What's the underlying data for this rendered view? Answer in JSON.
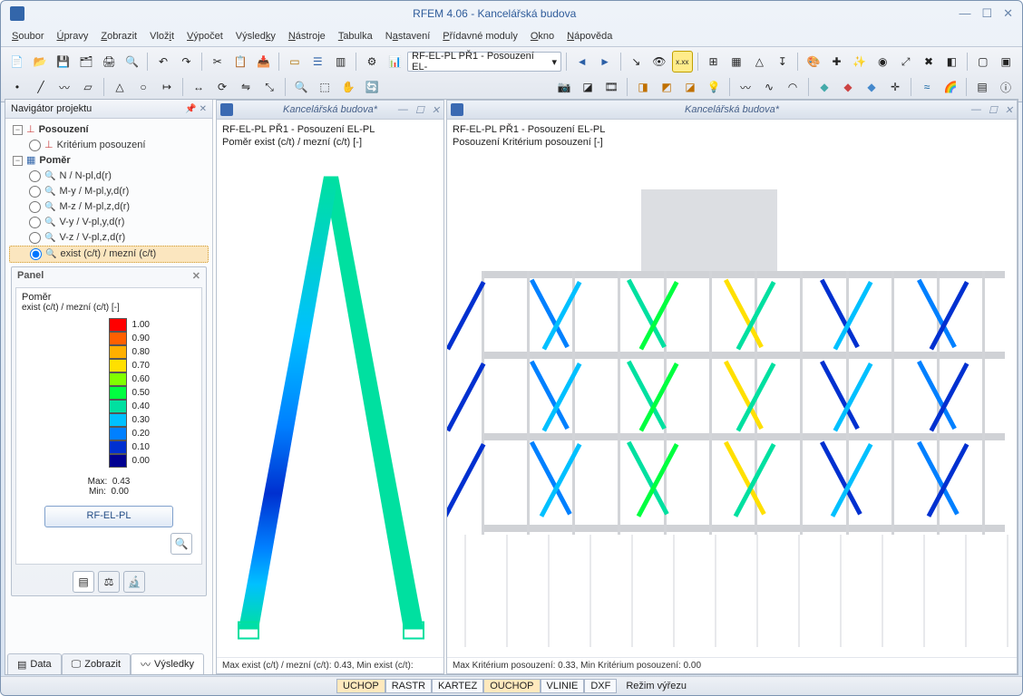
{
  "app": {
    "title": "RFEM 4.06 - Kancelářská budova"
  },
  "menu": {
    "items": [
      "Soubor",
      "Úpravy",
      "Zobrazit",
      "Vložit",
      "Výpočet",
      "Výsledky",
      "Nástroje",
      "Tabulka",
      "Nastavení",
      "Přídavné moduly",
      "Okno",
      "Nápověda"
    ]
  },
  "toolbar": {
    "combo": "RF-EL-PL PŘ1 - Posouzení EL-"
  },
  "navigator": {
    "title": "Navigátor projektu",
    "nodes": {
      "posouzeni": "Posouzení",
      "kriterium": "Kritérium posouzení",
      "pomer": "Poměr",
      "n": "N / N-pl,d(r)",
      "my": "M-y / M-pl,y,d(r)",
      "mz": "M-z / M-pl,z,d(r)",
      "vy": "V-y / V-pl,y,d(r)",
      "vz": "V-z / V-pl,z,d(r)",
      "exist": "exist (c/t) / mezní (c/t)"
    },
    "tabs": {
      "data": "Data",
      "zobrazit": "Zobrazit",
      "vysledky": "Výsledky"
    }
  },
  "panel": {
    "title": "Panel",
    "heading_l1": "Poměr",
    "heading_l2": "exist (c/t) / mezní (c/t) [-]",
    "legend": [
      {
        "v": "1.00",
        "c": "#ff0000"
      },
      {
        "v": "0.90",
        "c": "#ff6000"
      },
      {
        "v": "0.80",
        "c": "#ffb000"
      },
      {
        "v": "0.70",
        "c": "#ffe000"
      },
      {
        "v": "0.60",
        "c": "#80ff00"
      },
      {
        "v": "0.50",
        "c": "#00ff40"
      },
      {
        "v": "0.40",
        "c": "#00e0a0"
      },
      {
        "v": "0.30",
        "c": "#00c0ff"
      },
      {
        "v": "0.20",
        "c": "#0080ff"
      },
      {
        "v": "0.10",
        "c": "#0030d0"
      },
      {
        "v": "0.00",
        "c": "#000090"
      }
    ],
    "max_label": "Max:",
    "max_value": "0.43",
    "min_label": "Min:",
    "min_value": "0.00",
    "button": "RF-EL-PL"
  },
  "view_left": {
    "title": "Kancelářská budova*",
    "l1": "RF-EL-PL PŘ1 - Posouzení EL-PL",
    "l2": "Poměr exist (c/t) / mezní (c/t) [-]",
    "foot": "Max exist (c/t) / mezní (c/t): 0.43, Min exist (c/t):"
  },
  "view_right": {
    "title": "Kancelářská budova*",
    "l1": "RF-EL-PL PŘ1 - Posouzení EL-PL",
    "l2": "Posouzení Kritérium posouzení [-]",
    "foot": "Max Kritérium posouzení: 0.33, Min Kritérium posouzení: 0.00"
  },
  "status": {
    "cells": [
      "UCHOP",
      "RASTR",
      "KARTEZ",
      "OUCHOP",
      "VLINIE",
      "DXF"
    ],
    "mode": "Režim výřezu"
  },
  "chart_data": {
    "type": "heatmap",
    "title": "exist (c/t) / mezní (c/t)",
    "range": [
      0.0,
      1.0
    ],
    "computed_max": 0.43,
    "computed_min": 0.0,
    "right_view": {
      "max": 0.33,
      "min": 0.0
    },
    "colormap": [
      [
        0.0,
        "#000090"
      ],
      [
        0.1,
        "#0030d0"
      ],
      [
        0.2,
        "#0080ff"
      ],
      [
        0.3,
        "#00c0ff"
      ],
      [
        0.4,
        "#00e0a0"
      ],
      [
        0.5,
        "#00ff40"
      ],
      [
        0.6,
        "#80ff00"
      ],
      [
        0.7,
        "#ffe000"
      ],
      [
        0.8,
        "#ffb000"
      ],
      [
        0.9,
        "#ff6000"
      ],
      [
        1.0,
        "#ff0000"
      ]
    ]
  }
}
